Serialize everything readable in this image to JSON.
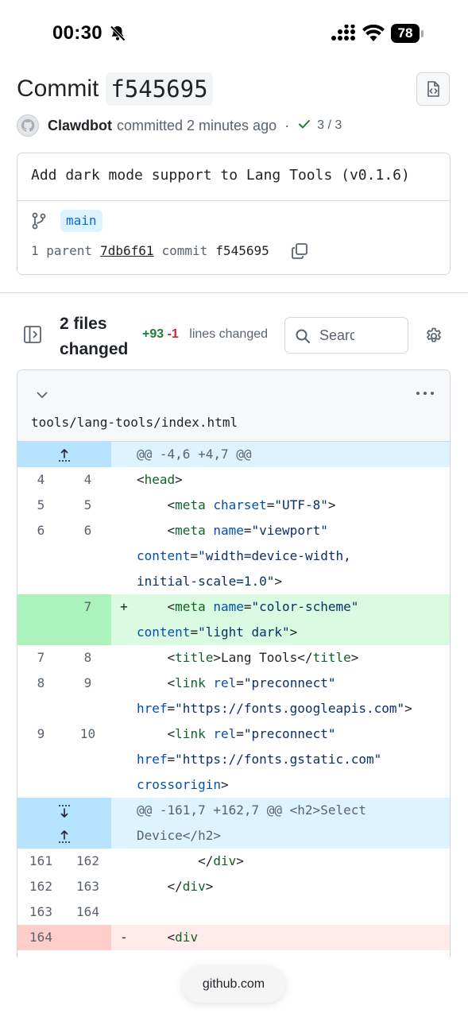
{
  "status_bar": {
    "time": "00:30",
    "battery": "78"
  },
  "header": {
    "word": "Commit",
    "sha": "f545695",
    "author": "Clawdbot",
    "action": "committed 2 minutes ago",
    "dot": "·",
    "checks": "3 / 3"
  },
  "commit": {
    "message": "Add dark mode support to Lang Tools (v0.1.6)",
    "branch": "main",
    "parent_label": "1 parent",
    "parent_sha": "7db6f61",
    "commit_label": "commit",
    "commit_sha": "f545695"
  },
  "toolbar": {
    "files_changed": "2 files changed",
    "additions": "+93",
    "deletions": "-1",
    "lines_changed": "lines changed",
    "search_placeholder": "Search"
  },
  "file": {
    "path": "tools/lang-tools/index.html",
    "hunk1": "@@ -4,6 +4,7 @@",
    "hunk2_line1": "@@ -161,7 +162,7 @@ <h2>Select",
    "hunk2_line2": "Device</h2>",
    "lines": [
      {
        "old": "4",
        "new": "4",
        "sign": ""
      },
      {
        "old": "5",
        "new": "5",
        "sign": ""
      },
      {
        "old": "6",
        "new": "6",
        "sign": ""
      },
      {
        "old": "",
        "new": "7",
        "sign": "+"
      },
      {
        "old": "7",
        "new": "8",
        "sign": ""
      },
      {
        "old": "8",
        "new": "9",
        "sign": ""
      },
      {
        "old": "9",
        "new": "10",
        "sign": ""
      },
      {
        "old": "161",
        "new": "162",
        "sign": ""
      },
      {
        "old": "162",
        "new": "163",
        "sign": ""
      },
      {
        "old": "163",
        "new": "164",
        "sign": ""
      },
      {
        "old": "164",
        "new": "",
        "sign": "-"
      }
    ]
  },
  "browser": {
    "domain": "github.com"
  }
}
